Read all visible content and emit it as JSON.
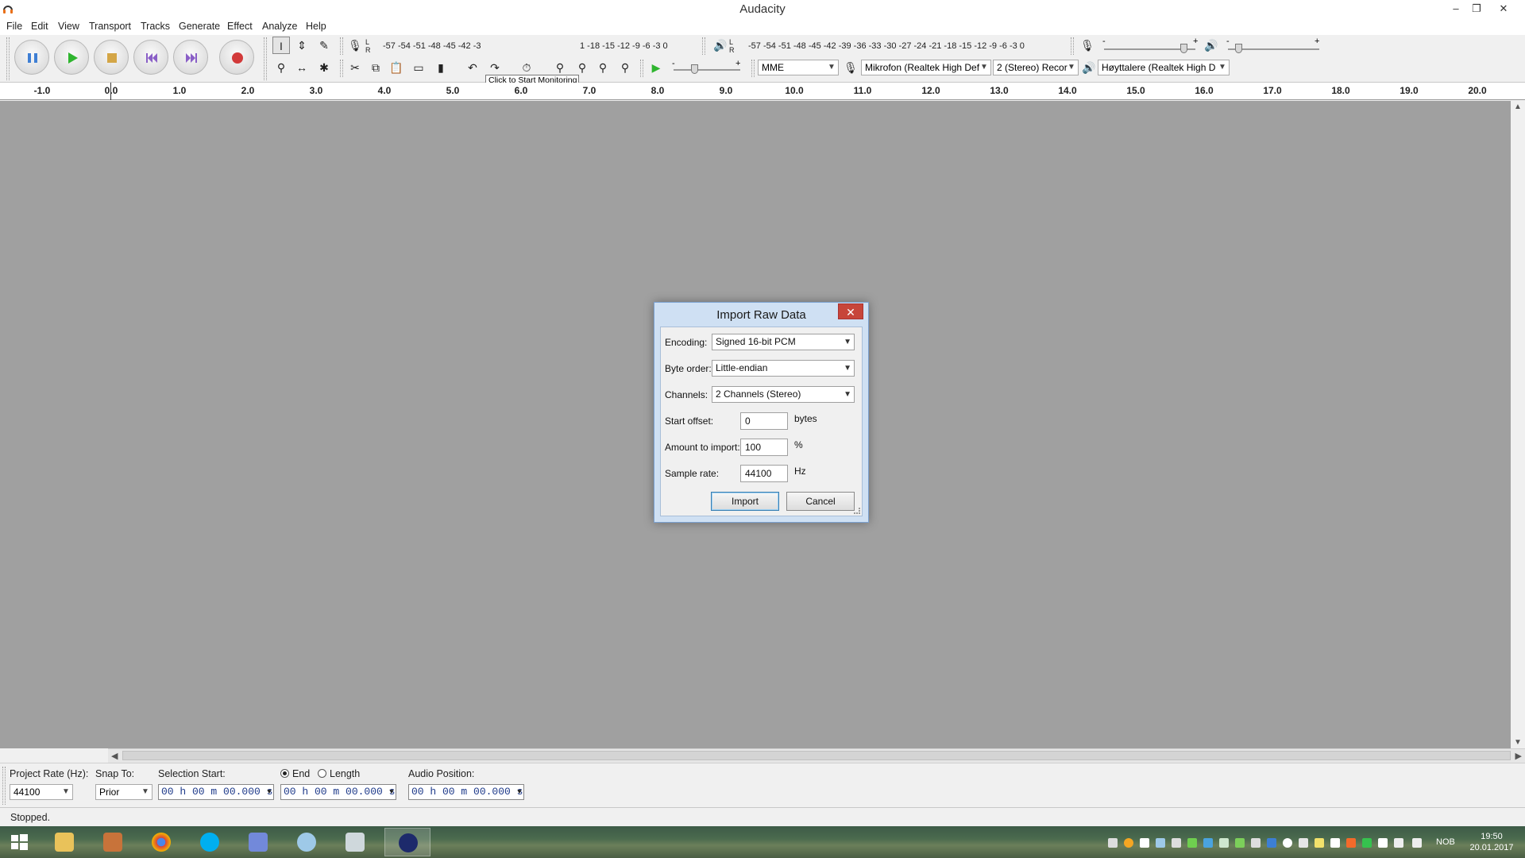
{
  "window": {
    "title": "Audacity"
  },
  "menu": [
    "File",
    "Edit",
    "View",
    "Transport",
    "Tracks",
    "Generate",
    "Effect",
    "Analyze",
    "Help"
  ],
  "recording_meter": {
    "scale": "-57 -54 -51 -48 -45 -42 -3",
    "scale_right": "1 -18 -15 -12 -9 -6 -3 0",
    "tooltip": "Click to Start Monitoring",
    "lr": "L\nR"
  },
  "playback_meter": {
    "scale": "-57 -54 -51 -48 -45 -42 -39 -36 -33 -30 -27 -24 -21 -18 -15 -12 -9 -6 -3 0",
    "lr": "L\nR"
  },
  "device_toolbar": {
    "host": "MME",
    "recording_device": "Mikrofon (Realtek High Def",
    "recording_channels": "2 (Stereo) Recor",
    "playback_device": "Høyttalere (Realtek High D"
  },
  "mixer": {
    "minus": "-",
    "plus": "+"
  },
  "ruler": {
    "labels": [
      "-1.0",
      "0.0",
      "1.0",
      "2.0",
      "3.0",
      "4.0",
      "5.0",
      "6.0",
      "7.0",
      "8.0",
      "9.0",
      "10.0",
      "11.0",
      "12.0",
      "13.0",
      "14.0",
      "15.0",
      "16.0",
      "17.0",
      "18.0",
      "19.0",
      "20.0"
    ]
  },
  "dialog": {
    "title": "Import Raw Data",
    "close": "✕",
    "encoding_label": "Encoding:",
    "encoding_value": "Signed 16-bit PCM",
    "byte_order_label": "Byte order:",
    "byte_order_value": "Little-endian",
    "channels_label": "Channels:",
    "channels_value": "2 Channels (Stereo)",
    "start_offset_label": "Start offset:",
    "start_offset_value": "0",
    "start_offset_unit": "bytes",
    "amount_label": "Amount to import:",
    "amount_value": "100",
    "amount_unit": "%",
    "sample_rate_label": "Sample rate:",
    "sample_rate_value": "44100",
    "sample_rate_unit": "Hz",
    "import_button": "Import",
    "cancel_button": "Cancel"
  },
  "selection_toolbar": {
    "project_rate_label": "Project Rate (Hz):",
    "project_rate_value": "44100",
    "snap_to_label": "Snap To:",
    "snap_to_value": "Prior",
    "selection_start_label": "Selection Start:",
    "selection_start_value": "00 h 00 m 00.000 s",
    "end_label": "End",
    "length_label": "Length",
    "end_value": "00 h 00 m 00.000 s",
    "audio_position_label": "Audio Position:",
    "audio_position_value": "00 h 00 m 00.000 s"
  },
  "status": {
    "text": "Stopped."
  },
  "taskbar": {
    "language": "NOB",
    "time": "19:50",
    "date": "20.01.2017",
    "apps": [
      "file-explorer",
      "app-2",
      "chrome",
      "skype",
      "discord",
      "paint",
      "app-7",
      "audacity"
    ]
  },
  "colors": {
    "track_area": "#a0a0a0",
    "dialog_frame": "#cfe0f3",
    "close_red": "#c7453a",
    "play_green": "#2fb52f",
    "record_red": "#d23a3a"
  }
}
